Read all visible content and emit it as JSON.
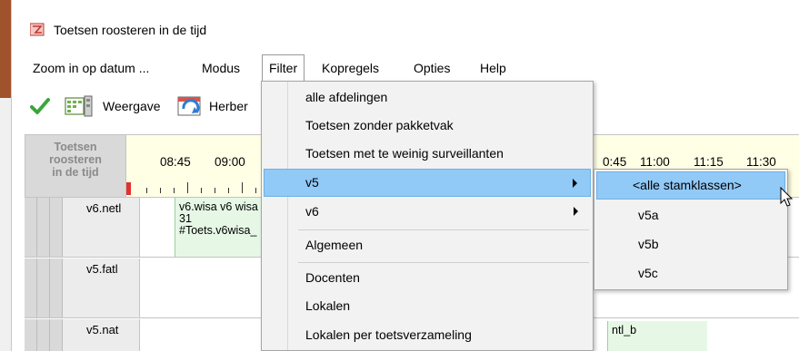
{
  "window": {
    "title": "Toetsen roosteren in de tijd"
  },
  "menubar": {
    "items": [
      "Zoom in op datum ...",
      "Modus",
      "Filter",
      "Kopregels",
      "Opties",
      "Help"
    ]
  },
  "toolbar": {
    "weergave_label": "Weergave",
    "herbereken_label": "Herber"
  },
  "grid": {
    "corner_lines": [
      "Toetsen",
      "roosteren",
      "in de tijd"
    ],
    "times_left": [
      "08:45",
      "09:00"
    ],
    "times_right": [
      "0:45",
      "11:00",
      "11:15",
      "11:30"
    ],
    "rows": [
      {
        "class": "v6.netl",
        "cell_lines": [
          "v6.wisa v6 wisa",
          "31",
          "#Toets.v6wisa_"
        ]
      },
      {
        "class": "v5.fatl",
        "cell_lines": []
      },
      {
        "class": "v5.nat",
        "cell_lines": [],
        "right_cell": "ntl_b"
      }
    ]
  },
  "filter_menu": {
    "items": [
      {
        "label": "alle afdelingen"
      },
      {
        "label": "Toetsen zonder pakketvak"
      },
      {
        "label": "Toetsen met te weinig surveillanten"
      },
      {
        "label": "v5"
      },
      {
        "label": "v6"
      },
      {
        "label": "Algemeen"
      },
      {
        "label": "Docenten"
      },
      {
        "label": "Lokalen"
      },
      {
        "label": "Lokalen per toetsverzameling"
      }
    ]
  },
  "v5_submenu": {
    "items": [
      "<alle stamklassen>",
      "v5a",
      "v5b",
      "v5c"
    ]
  },
  "colors": {
    "highlight": "#91c9f7",
    "timeline_bg": "#ffffe6",
    "cell_green": "#e6f7e6"
  }
}
